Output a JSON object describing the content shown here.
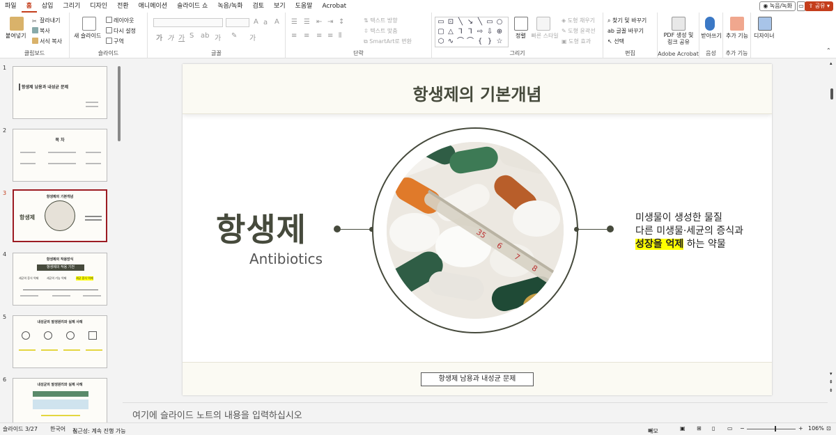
{
  "menu": {
    "tabs": [
      "파일",
      "홈",
      "삽입",
      "그리기",
      "디자인",
      "전환",
      "애니메이션",
      "슬라이드 쇼",
      "녹음/녹화",
      "검토",
      "보기",
      "도움말",
      "Acrobat"
    ],
    "active_index": 1,
    "record_label": "녹음/녹화",
    "comment_icon": "comment-icon",
    "share_label": "공유"
  },
  "ribbon": {
    "clipboard": {
      "paste": "붙여넣기",
      "cut": "잘라내기",
      "copy": "복사",
      "format_painter": "서식 복사",
      "label": "클립보드"
    },
    "slides": {
      "new_slide": "새 슬라이드",
      "layout": "레이아웃",
      "reset": "다시 설정",
      "section": "구역",
      "label": "슬라이드"
    },
    "font": {
      "label": "글꼴"
    },
    "paragraph": {
      "text_direction": "텍스트 방향",
      "align_text": "텍스트 맞춤",
      "smartart": "SmartArt로 변환",
      "label": "단락"
    },
    "drawing": {
      "arrange": "정렬",
      "quick_styles": "빠른 스타일",
      "shape_fill": "도형 채우기",
      "shape_outline": "도형 윤곽선",
      "shape_effects": "도형 효과",
      "label": "그리기"
    },
    "editing": {
      "find": "찾기 및 바꾸기",
      "replace": "글꼴 바꾸기",
      "select": "선택",
      "label": "편집"
    },
    "acrobat": {
      "create_pdf": "PDF 생성 및 링크 공유",
      "label": "Adobe Acrobat"
    },
    "voice": {
      "dictate": "받아쓰기",
      "label": "음성"
    },
    "addins": {
      "addins": "추가 기능",
      "label": "추가 기능"
    },
    "designer": {
      "label": "디자이너"
    }
  },
  "thumbnails": [
    {
      "num": "1",
      "text": "항생제 남용과 내성균 문제"
    },
    {
      "num": "2",
      "text": "목 차"
    },
    {
      "num": "3",
      "text": "항생제의 기본개념"
    },
    {
      "num": "4",
      "text": "항생제의 작용방식"
    },
    {
      "num": "5",
      "text": "내성균의 발생원리와 실제 사례"
    },
    {
      "num": "6",
      "text": "내성균의 발생원리와 실제 사례"
    }
  ],
  "thumb_small_texts": {
    "t3_word": "항생제",
    "t4_header": "항생제의 작용 기전",
    "t4_items": [
      "세균의 증식 억제",
      "세균의 기능 억제",
      "세균 증식 억제"
    ]
  },
  "slide": {
    "title": "항생제의 기본개념",
    "big_word": "항생제",
    "eng_word": "Antibiotics",
    "desc_line1": "미생물이 생성한 물질",
    "desc_line2": "다른 미생물·세균의 증식과",
    "desc_highlight": "성장을 억제",
    "desc_line3_rest": "하는 약물",
    "footer": "항생제 남용과 내성균 문제",
    "thermometer_nums": [
      "35",
      "6",
      "7",
      "8"
    ]
  },
  "notes": {
    "placeholder": "여기에 슬라이드 노트의 내용을 입력하십시오"
  },
  "status": {
    "slide_count": "슬라이드 3/27",
    "language": "한국어",
    "accessibility": "접근성: 계속 진행 가능",
    "notes_btn": "메모",
    "zoom": "106%"
  },
  "colors": {
    "accent": "#c43e1c",
    "slide_dark": "#464a3c",
    "highlight": "#ffff00"
  }
}
